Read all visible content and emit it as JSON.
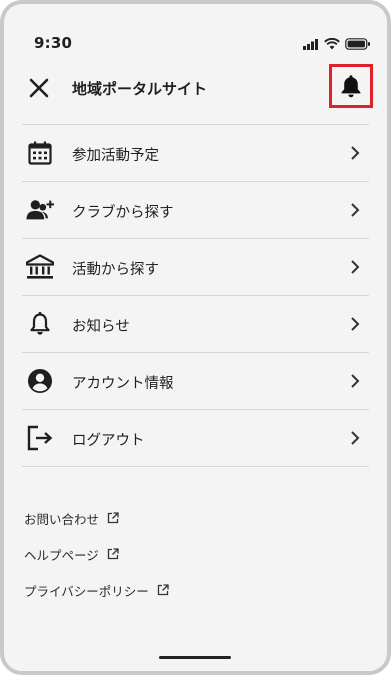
{
  "status": {
    "time": "9:30",
    "icons": [
      "signal-icon",
      "wifi-icon",
      "battery-icon"
    ]
  },
  "header": {
    "close_icon": "close-icon",
    "title": "地域ポータルサイト",
    "bell_icon": "bell-icon",
    "highlight_color": "#e0202a"
  },
  "menu": {
    "items": [
      {
        "label": "参加活動予定",
        "icon": "calendar-icon"
      },
      {
        "label": "クラブから探す",
        "icon": "add-user-group-icon"
      },
      {
        "label": "活動から探す",
        "icon": "building-icon"
      },
      {
        "label": "お知らせ",
        "icon": "bell-outline-icon"
      },
      {
        "label": "アカウント情報",
        "icon": "account-circle-icon"
      },
      {
        "label": "ログアウト",
        "icon": "logout-icon"
      }
    ]
  },
  "footer": {
    "links": [
      {
        "label": "お問い合わせ",
        "icon": "external-link-icon"
      },
      {
        "label": "ヘルプページ",
        "icon": "external-link-icon"
      },
      {
        "label": "プライバシーポリシー",
        "icon": "external-link-icon"
      }
    ]
  }
}
